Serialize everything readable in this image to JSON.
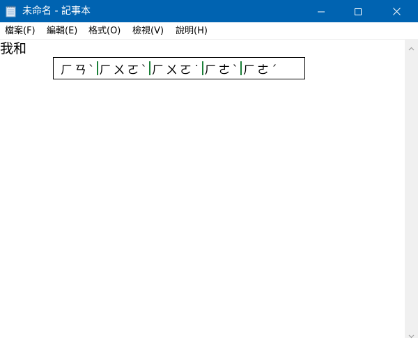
{
  "window": {
    "title": "未命名 - 記事本",
    "titlebar_color": "#0063b1"
  },
  "icons": {
    "app": "notepad-icon",
    "minimize": "minimize-icon",
    "maximize": "maximize-icon",
    "close": "close-icon",
    "scroll_up": "chevron-up-icon",
    "scroll_down": "chevron-down-icon"
  },
  "menu": {
    "items": [
      {
        "label": "檔案(F)"
      },
      {
        "label": "編輯(E)"
      },
      {
        "label": "格式(O)"
      },
      {
        "label": "檢視(V)"
      },
      {
        "label": "說明(H)"
      }
    ]
  },
  "editor": {
    "text": "我和"
  },
  "ime": {
    "candidates": [
      {
        "text": "ㄏㄢˋ"
      },
      {
        "text": "ㄏㄨㄛˋ"
      },
      {
        "text": "ㄏㄨㄛ˙"
      },
      {
        "text": "ㄏㄜˋ"
      },
      {
        "text": "ㄏㄜˊ"
      }
    ]
  }
}
